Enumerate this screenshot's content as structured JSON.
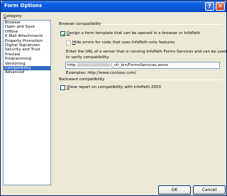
{
  "window": {
    "title": "Form Options",
    "help_glyph": "?",
    "close_glyph": "✕"
  },
  "sidebar": {
    "label_prefix": "C",
    "label_rest": "ategory:",
    "items": [
      {
        "label": "Browser",
        "selected": false
      },
      {
        "label": "Open and Save",
        "selected": false
      },
      {
        "label": "Offline",
        "selected": false
      },
      {
        "label": "E-Mail Attachments",
        "selected": false
      },
      {
        "label": "Property Promotion",
        "selected": false
      },
      {
        "label": "Digital Signatures",
        "selected": false
      },
      {
        "label": "Security and Trust",
        "selected": false
      },
      {
        "label": "Preview",
        "selected": false
      },
      {
        "label": "Programming",
        "selected": false
      },
      {
        "label": "Versioning",
        "selected": false
      },
      {
        "label": "Compatibility",
        "selected": true
      },
      {
        "label": "Advanced",
        "selected": false
      }
    ]
  },
  "browser_compat": {
    "group_title": "Browser compatibility",
    "design_checkbox": {
      "checked": true,
      "prefix": "D",
      "rest": "esign a form template that can be opened in a browser or InfoPath"
    },
    "hide_errors_checkbox": {
      "checked": false,
      "disabled": true,
      "prefix": "H",
      "rest": "ide errors for code that uses InfoPath-only features"
    },
    "url_description_line1": "Enter the URL of a server that is running InfoPath Forms Services and can be used",
    "url_description_line2": "to verify compatibility:",
    "url_value_start": "http:",
    "url_value_end": "/_vti_bin/FormsServices.asmx",
    "example_text": "Examples: http://www.contoso.com/"
  },
  "backward_compat": {
    "group_title": "Backward compatibility",
    "show_report_checkbox": {
      "checked": false,
      "prefix": "S",
      "rest": "how report on compatibility with InfoPath 2003"
    }
  },
  "buttons": {
    "ok": "OK",
    "cancel": "Cancel"
  }
}
